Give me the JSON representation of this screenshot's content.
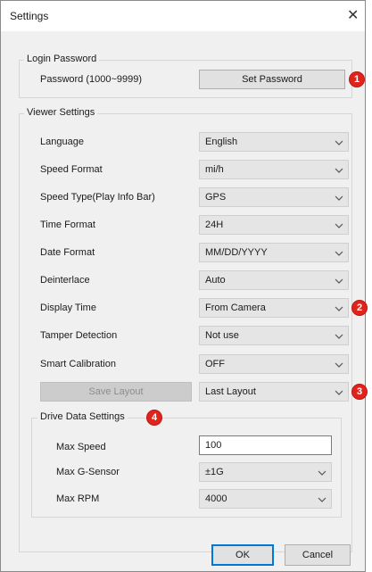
{
  "window": {
    "title": "Settings",
    "close_glyph": "✕"
  },
  "login": {
    "legend": "Login Password",
    "password_label": "Password (1000~9999)",
    "set_password_label": "Set Password"
  },
  "viewer": {
    "legend": "Viewer Settings",
    "rows": [
      {
        "label": "Language",
        "value": "English"
      },
      {
        "label": "Speed Format",
        "value": "mi/h"
      },
      {
        "label": "Speed Type(Play Info Bar)",
        "value": "GPS"
      },
      {
        "label": "Time Format",
        "value": "24H"
      },
      {
        "label": "Date Format",
        "value": "MM/DD/YYYY"
      },
      {
        "label": "Deinterlace",
        "value": "Auto"
      },
      {
        "label": "Display Time",
        "value": "From Camera"
      },
      {
        "label": "Tamper Detection",
        "value": "Not use"
      },
      {
        "label": "Smart Calibration",
        "value": "OFF"
      }
    ],
    "save_layout_label": "Save Layout",
    "layout_value": "Last Layout"
  },
  "drive": {
    "legend": "Drive Data Settings",
    "max_speed_label": "Max Speed",
    "max_speed_value": "100",
    "max_gsensor_label": "Max G-Sensor",
    "max_gsensor_value": "±1G",
    "max_rpm_label": "Max RPM",
    "max_rpm_value": "4000"
  },
  "footer": {
    "ok_label": "OK",
    "cancel_label": "Cancel"
  },
  "badges": {
    "b1": "1",
    "b2": "2",
    "b3": "3",
    "b4": "4"
  },
  "colors": {
    "badge": "#e0241c",
    "window_bg": "#f0f0f0",
    "select_bg": "#e5e5e5",
    "ok_border": "#0078d7"
  },
  "icons": {
    "dropdown": "chevron-down-icon",
    "close": "close-icon"
  }
}
